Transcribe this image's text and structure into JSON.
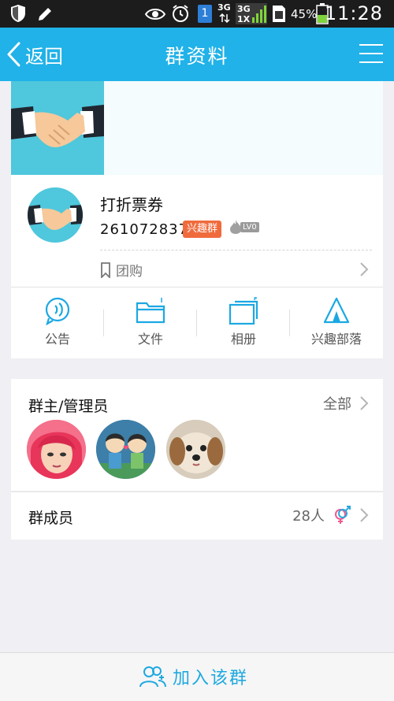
{
  "status_bar": {
    "network": "3G",
    "network_alt": "1X",
    "battery": "45%",
    "time": "11:28",
    "sim_number": "1"
  },
  "header": {
    "back_label": "返回",
    "title": "群资料"
  },
  "group": {
    "name": "打折票券",
    "id": "261072837",
    "badge": "兴趣群",
    "level": "LV0",
    "tag": "团购"
  },
  "features": [
    {
      "label": "公告",
      "icon": "announcement-icon"
    },
    {
      "label": "文件",
      "icon": "folder-icon"
    },
    {
      "label": "相册",
      "icon": "album-icon"
    },
    {
      "label": "兴趣部落",
      "icon": "tribe-icon"
    }
  ],
  "admins": {
    "title": "群主/管理员",
    "link": "全部"
  },
  "members": {
    "title": "群成员",
    "count": "28人"
  },
  "footer": {
    "join_label": "加入该群"
  },
  "colors": {
    "accent": "#20b2e8",
    "badge": "#f06b3c"
  }
}
